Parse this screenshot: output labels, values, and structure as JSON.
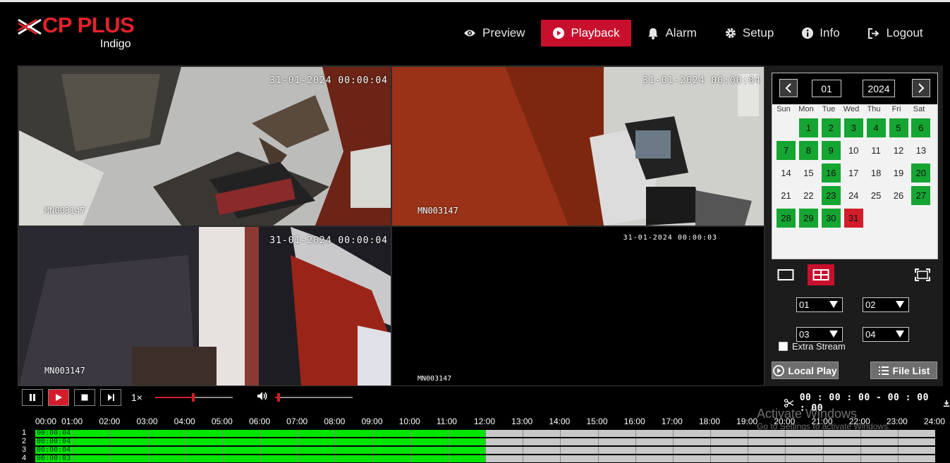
{
  "brand": {
    "name": "CP PLUS",
    "model": "Indigo"
  },
  "nav": [
    {
      "label": "Preview",
      "icon": "eye-icon",
      "active": false
    },
    {
      "label": "Playback",
      "icon": "play-circle-icon",
      "active": true
    },
    {
      "label": "Alarm",
      "icon": "bell-icon",
      "active": false
    },
    {
      "label": "Setup",
      "icon": "gear-icon",
      "active": false
    },
    {
      "label": "Info",
      "icon": "info-icon",
      "active": false
    },
    {
      "label": "Logout",
      "icon": "logout-icon",
      "active": false
    }
  ],
  "tiles": [
    {
      "timestamp": "31-01-2024 00:00:04",
      "osd": "MN003147"
    },
    {
      "timestamp": "31-01-2024 00:00:04",
      "osd": "MN003147"
    },
    {
      "timestamp": "31-01-2024 00:00:04",
      "osd": "MN003147"
    },
    {
      "timestamp": "31-01-2024 00:00:03",
      "osd": "MN003147"
    }
  ],
  "calendar": {
    "month": "01",
    "year": "2024",
    "weekdays": [
      "Sun",
      "Mon",
      "Tue",
      "Wed",
      "Thu",
      "Fri",
      "Sat"
    ],
    "first_weekday": 1,
    "days_in_month": 31,
    "recorded_days": [
      1,
      2,
      3,
      4,
      5,
      6,
      7,
      8,
      9,
      16,
      20,
      23,
      27,
      28,
      29,
      30
    ],
    "current_day": 31
  },
  "channels": [
    "01",
    "02",
    "03",
    "04"
  ],
  "extra_stream_label": "Extra Stream",
  "local_play_label": "Local Play",
  "file_list_label": "File List",
  "playback": {
    "speed": "1×",
    "progress": 0.49,
    "volume": 0.03
  },
  "clip_time": "00 : 00 : 00 - 00 : 00 : 00",
  "timeline": {
    "hours": [
      "00:00",
      "01:00",
      "02:00",
      "03:00",
      "04:00",
      "05:00",
      "06:00",
      "07:00",
      "08:00",
      "09:00",
      "10:00",
      "11:00",
      "12:00",
      "13:00",
      "14:00",
      "15:00",
      "16:00",
      "17:00",
      "18:00",
      "19:00",
      "20:00",
      "21:00",
      "22:00",
      "23:00",
      "24:00"
    ],
    "rows": [
      {
        "label": "1",
        "start_text": "00:00:04",
        "recorded_until_hour": 12
      },
      {
        "label": "2",
        "start_text": "00:00:04",
        "recorded_until_hour": 12
      },
      {
        "label": "3",
        "start_text": "00:00:04",
        "recorded_until_hour": 12
      },
      {
        "label": "4",
        "start_text": "00:00:03",
        "recorded_until_hour": 12
      }
    ]
  },
  "watermark": {
    "line1": "Activate Windows",
    "line2": "Go to Settings to activate Windows."
  }
}
